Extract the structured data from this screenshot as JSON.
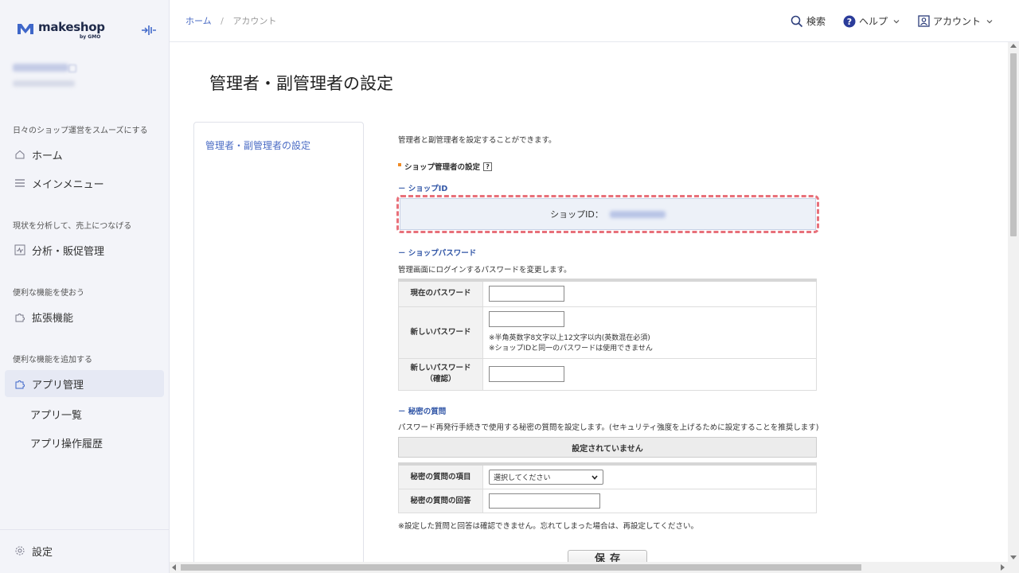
{
  "brand": {
    "name": "makeshop",
    "sub": "by GMO"
  },
  "sidebar": {
    "sections": [
      {
        "label": "日々のショップ運営をスムーズにする"
      },
      {
        "label": "現状を分析して、売上につなげる"
      },
      {
        "label": "便利な機能を使おう"
      },
      {
        "label": "便利な機能を追加する"
      }
    ],
    "items": [
      {
        "label": "ホーム"
      },
      {
        "label": "メインメニュー"
      },
      {
        "label": "分析・販促管理"
      },
      {
        "label": "拡張機能"
      },
      {
        "label": "アプリ管理"
      }
    ],
    "sub_items": [
      {
        "label": "アプリ一覧"
      },
      {
        "label": "アプリ操作履歴"
      }
    ],
    "settings_label": "設定"
  },
  "header": {
    "breadcrumb": {
      "home": "ホーム",
      "sep": "/",
      "current": "アカウント"
    },
    "search": "検索",
    "help": "ヘルプ",
    "account": "アカウント"
  },
  "page": {
    "title": "管理者・副管理者の設定",
    "side_link": "管理者・副管理者の設定",
    "description": "管理者と副管理者を設定することができます。",
    "section_title": "ショップ管理者の設定",
    "help_mark": "?",
    "shop_id": {
      "heading": "－ ショップID",
      "label": "ショップID："
    },
    "password": {
      "heading": "－ ショップパスワード",
      "description": "管理画面にログインするパスワードを変更します。",
      "current_label": "現在のパスワード",
      "new_label": "新しいパスワード",
      "hint1": "※半角英数字8文字以上12文字以内(英数混在必須)",
      "hint2": "※ショップIDと同一のパスワードは使用できません",
      "confirm_label_1": "新しいパスワード",
      "confirm_label_2": "（確認）"
    },
    "secret": {
      "heading": "－ 秘密の質問",
      "description": "パスワード再発行手続きで使用する秘密の質問を設定します。(セキュリティ強度を上げるために設定することを推奨します)",
      "status": "設定されていません",
      "question_label": "秘密の質問の項目",
      "question_value": "選択してください",
      "answer_label": "秘密の質問の回答",
      "note": "※設定した質問と回答は確認できません。忘れてしまった場合は、再設定してください。"
    },
    "save_label": "保存"
  }
}
